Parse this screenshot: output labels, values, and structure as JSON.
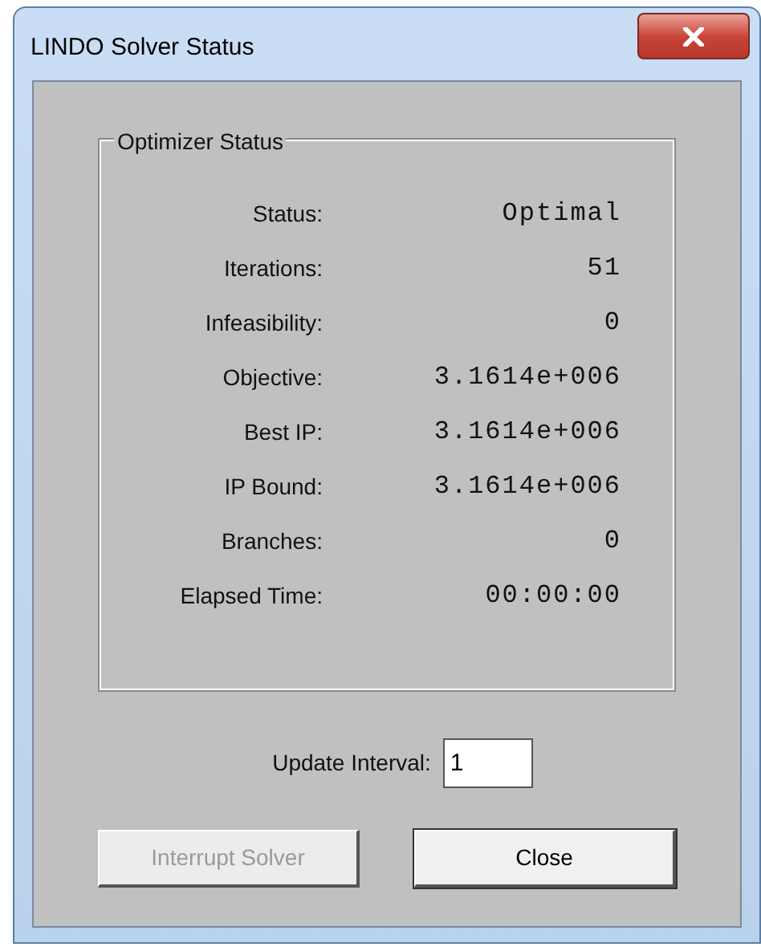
{
  "window": {
    "title": "LINDO Solver Status"
  },
  "group": {
    "title": "Optimizer Status",
    "rows": [
      {
        "label": "Status:",
        "value": "Optimal"
      },
      {
        "label": "Iterations:",
        "value": "51"
      },
      {
        "label": "Infeasibility:",
        "value": "0"
      },
      {
        "label": "Objective:",
        "value": "3.1614e+006"
      },
      {
        "label": "Best IP:",
        "value": "3.1614e+006"
      },
      {
        "label": "IP Bound:",
        "value": "3.1614e+006"
      },
      {
        "label": "Branches:",
        "value": "0"
      },
      {
        "label": "Elapsed Time:",
        "value": "00:00:00"
      }
    ]
  },
  "update_interval": {
    "label": "Update Interval:",
    "value": "1"
  },
  "buttons": [
    {
      "label": "Interrupt Solver",
      "disabled": true
    },
    {
      "label": "Close",
      "disabled": false
    }
  ]
}
